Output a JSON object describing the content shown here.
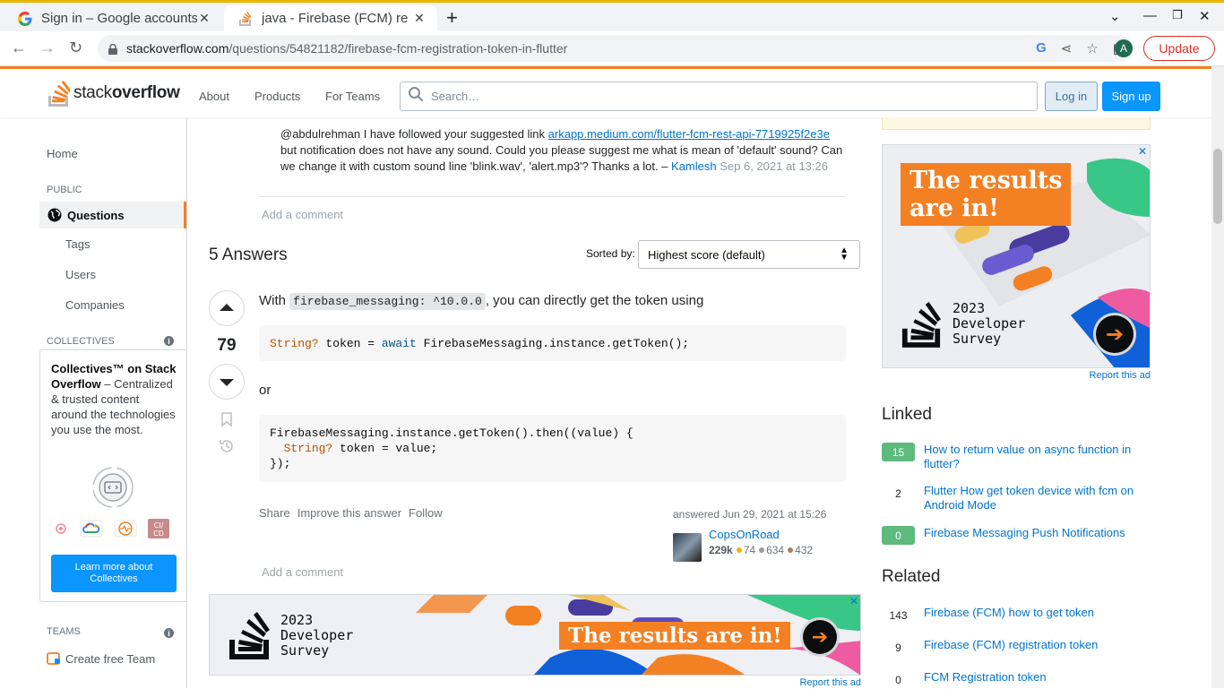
{
  "browser": {
    "tabs": [
      {
        "title": "Sign in – Google accounts",
        "close": "✕"
      },
      {
        "title": "java - Firebase (FCM) registration token in flutter",
        "close": "✕"
      }
    ],
    "new_tab": "+",
    "url_host": "stackoverflow.com",
    "url_path": "/questions/54821182/firebase-fcm-registration-token-in-flutter",
    "avatar_letter": "A",
    "update_label": "Update"
  },
  "so_header": {
    "logo_text_light": "stack",
    "logo_text_bold": "overflow",
    "nav": [
      "About",
      "Products",
      "For Teams"
    ],
    "search_placeholder": "Search…",
    "login": "Log in",
    "signup": "Sign up"
  },
  "leftnav": {
    "home": "Home",
    "public_head": "PUBLIC",
    "questions": "Questions",
    "tags": "Tags",
    "users": "Users",
    "companies": "Companies",
    "collectives_head": "COLLECTIVES",
    "coll_title": "Collectives™ on Stack Overflow",
    "coll_dash": " –",
    "coll_desc": "Centralized & trusted content around the technologies you use the most.",
    "coll_learn": "Learn more about Collectives",
    "teams_head": "TEAMS",
    "create_team": "Create free Team"
  },
  "comment": {
    "pre": "@abdulrehman I have followed your suggested link ",
    "link": "arkapp.medium.com/flutter-fcm-rest-api-7719925f2e3e",
    "post": " but notification does not have any sound. Could you please suggest me what is mean of 'default' sound? Can we change it with custom sound line 'blink.wav', 'alert.mp3'? Thanks a lot. – ",
    "user": "Kamlesh",
    "date": " Sep 6, 2021 at 13:26"
  },
  "add_comment": "Add a comment",
  "answers": {
    "count_label": "5 Answers",
    "sorted_by": "Sorted by:",
    "sort_value": "Highest score (default)"
  },
  "answer": {
    "votes": "79",
    "intro_pre": "With ",
    "intro_code": "firebase_messaging: ^10.0.0",
    "intro_post": ", you can directly get the token using",
    "code1_type": "String?",
    "code1_mid": " token = ",
    "code1_kw": "await",
    "code1_rest": " FirebaseMessaging.instance.getToken();",
    "or": "or",
    "code2_line1": "FirebaseMessaging.instance.getToken().then((value) {",
    "code2_type": "String?",
    "code2_line2": " token = value;",
    "code2_line3": "});",
    "menu": [
      "Share",
      "Improve this answer",
      "Follow"
    ],
    "answered": "answered Jun 29, 2021 at 15:26",
    "user": "CopsOnRoad",
    "rep": "229k",
    "gold": "74",
    "silver": "634",
    "bronze": "432"
  },
  "ads": {
    "results": "The results are in!",
    "results_l1": "The results",
    "results_l2": "are in!",
    "survey_year": "2023",
    "survey_l1": "Developer",
    "survey_l2": "Survey",
    "report": "Report this ad",
    "close": "✕"
  },
  "linked": {
    "head": "Linked",
    "items": [
      {
        "score": "15",
        "title": "How to return value on async function in flutter?",
        "accepted": true
      },
      {
        "score": "2",
        "title": "Flutter How get token device with fcm on Android Mode",
        "accepted": false
      },
      {
        "score": "0",
        "title": "Firebase Messaging Push Notifications",
        "accepted": true
      }
    ]
  },
  "related": {
    "head": "Related",
    "items": [
      {
        "score": "143",
        "title": "Firebase (FCM) how to get token"
      },
      {
        "score": "9",
        "title": "Firebase (FCM) registration token"
      },
      {
        "score": "0",
        "title": "FCM Registration token"
      }
    ]
  },
  "colors": {
    "accent": "#f48024",
    "link": "#0074cc",
    "accepted": "#5eba7d",
    "button_blue": "#0a95ff"
  }
}
